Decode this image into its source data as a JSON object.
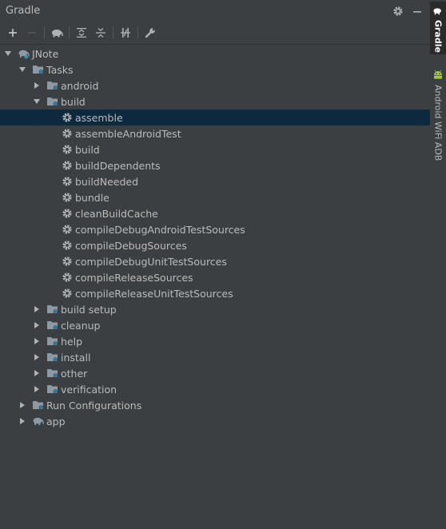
{
  "panel": {
    "title": "Gradle"
  },
  "sidebar": {
    "tabs": [
      {
        "label": "Gradle"
      },
      {
        "label": "Android WiFi ADB"
      }
    ]
  },
  "tree": {
    "root": "JNote",
    "tasks": "Tasks",
    "groups": {
      "android": "android",
      "build": "build",
      "build_setup": "build setup",
      "cleanup": "cleanup",
      "help": "help",
      "install": "install",
      "other": "other",
      "verification": "verification"
    },
    "build_tasks": [
      "assemble",
      "assembleAndroidTest",
      "build",
      "buildDependents",
      "buildNeeded",
      "bundle",
      "cleanBuildCache",
      "compileDebugAndroidTestSources",
      "compileDebugSources",
      "compileDebugUnitTestSources",
      "compileReleaseSources",
      "compileReleaseUnitTestSources"
    ],
    "run_configurations": "Run Configurations",
    "app": "app",
    "selected": "assemble"
  },
  "colors": {
    "background": "#3c3f41",
    "selection": "#0d293e",
    "folder": "#8c9aa6",
    "badge": "#3592c4",
    "android_green": "#a4c639"
  }
}
